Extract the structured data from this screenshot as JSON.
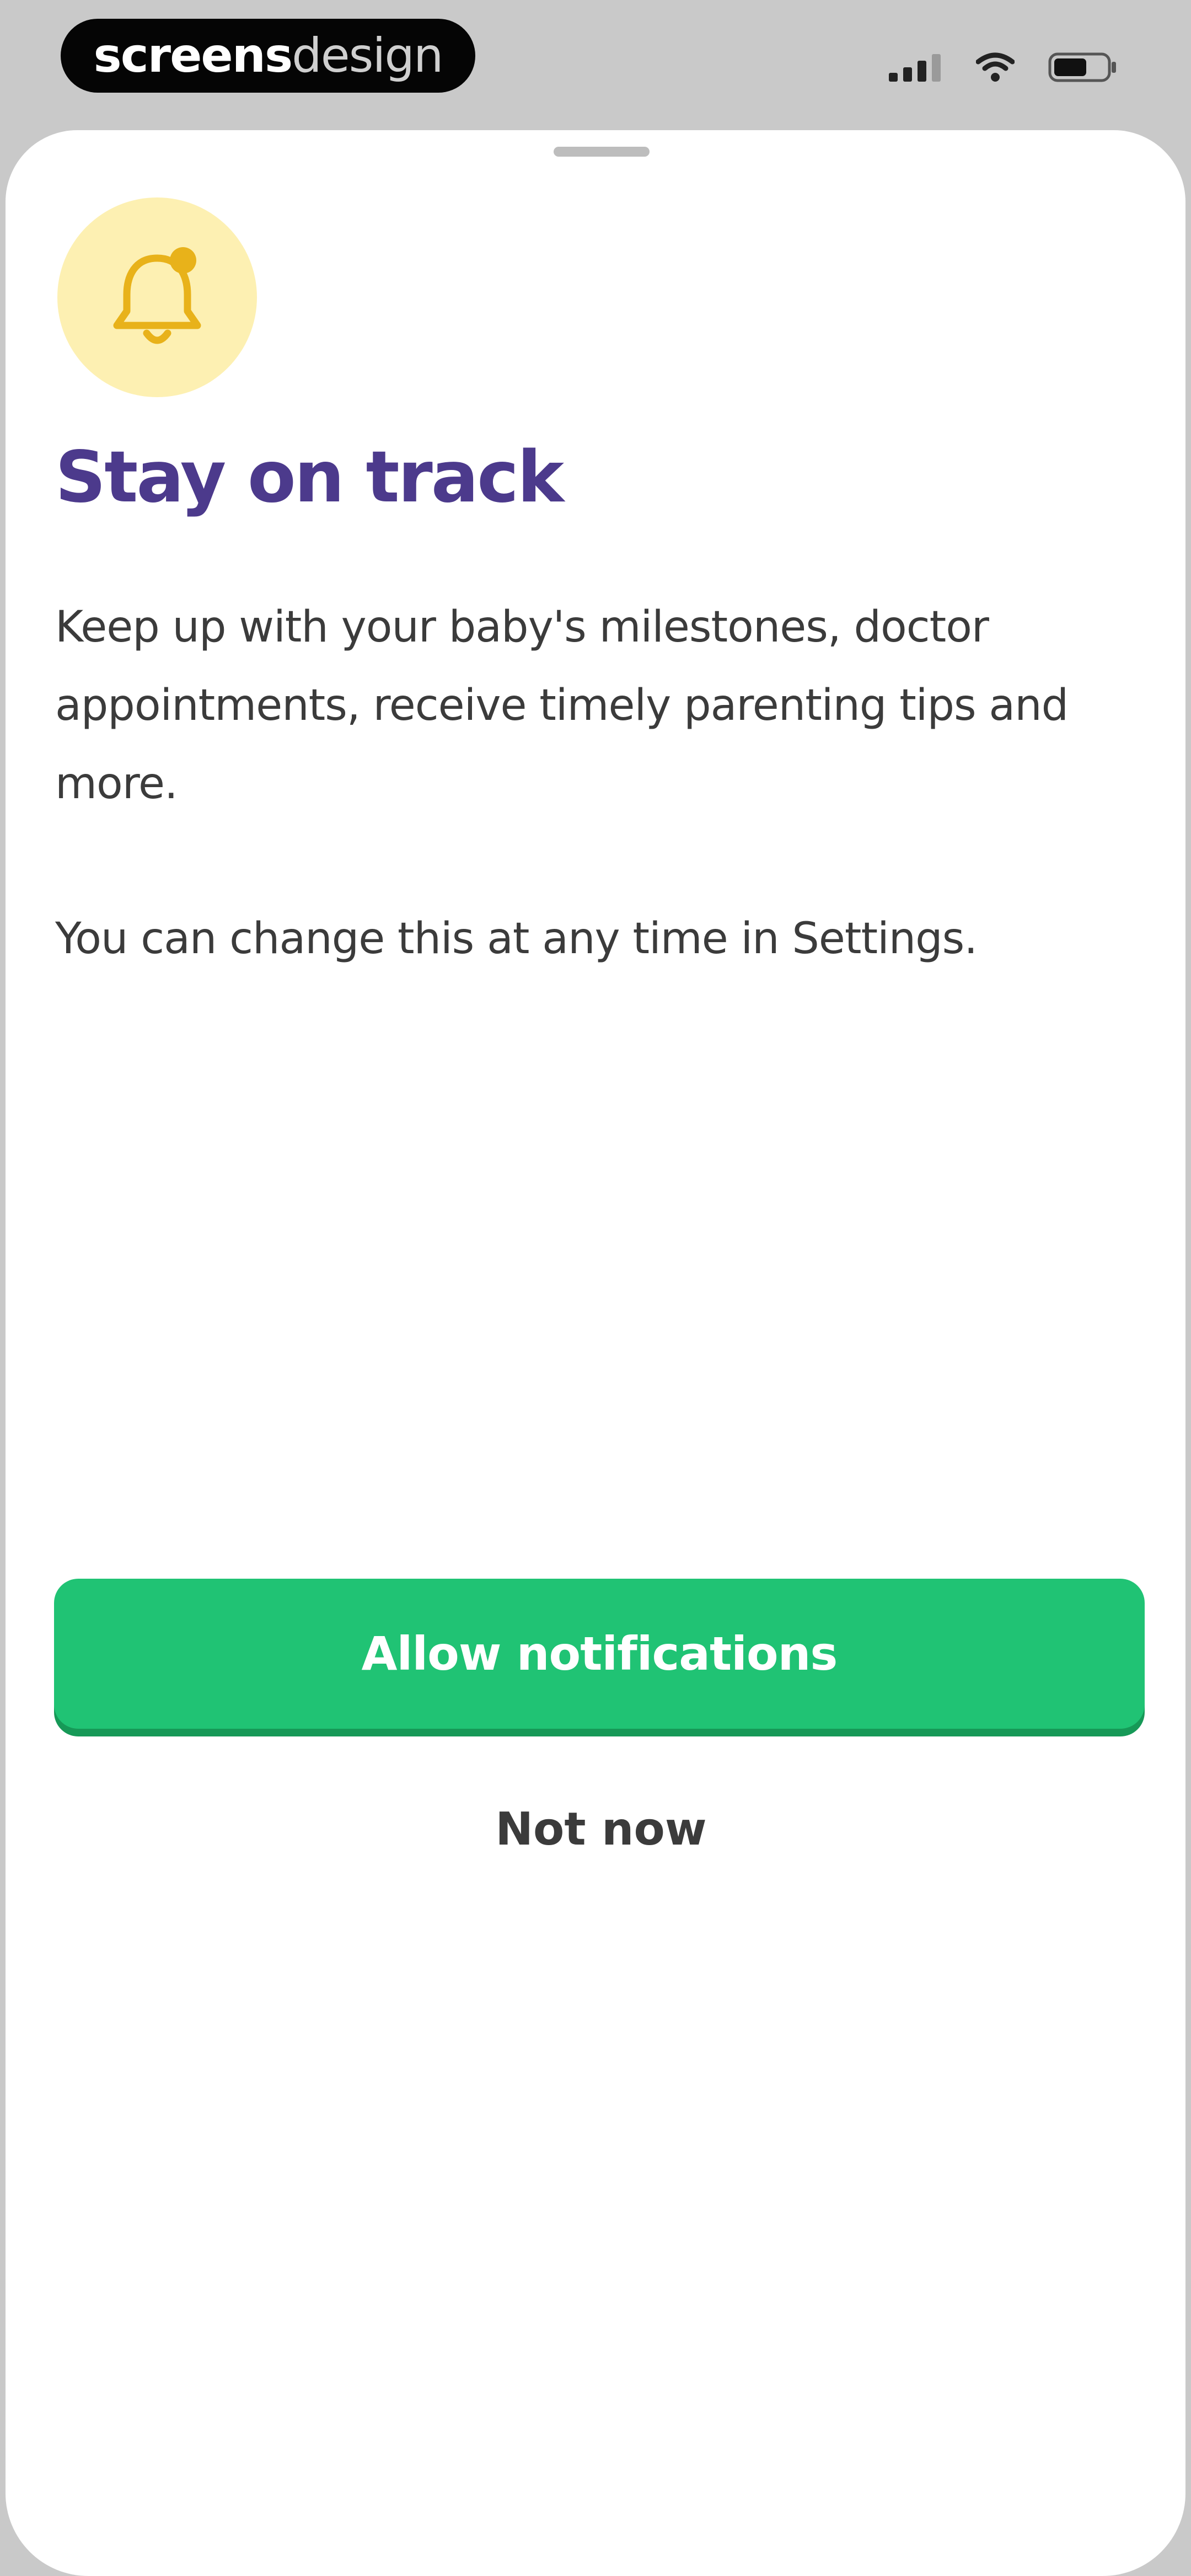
{
  "status_bar": {
    "watermark_bold": "screens",
    "watermark_light": "design",
    "icons": [
      "signal-icon",
      "wifi-icon",
      "battery-icon"
    ]
  },
  "sheet": {
    "icon": "bell-icon",
    "icon_color": "#e8b21a",
    "icon_bg_color": "#fdf0b2",
    "title": "Stay on track",
    "title_color": "#4c3a8c",
    "body_paragraphs": [
      "Keep up with your baby's milestones, doctor appointments, receive timely parenting tips and more.",
      "You can change this at any time in Settings."
    ]
  },
  "actions": {
    "primary_label": "Allow notifications",
    "primary_color": "#20c374",
    "secondary_label": "Not now"
  }
}
